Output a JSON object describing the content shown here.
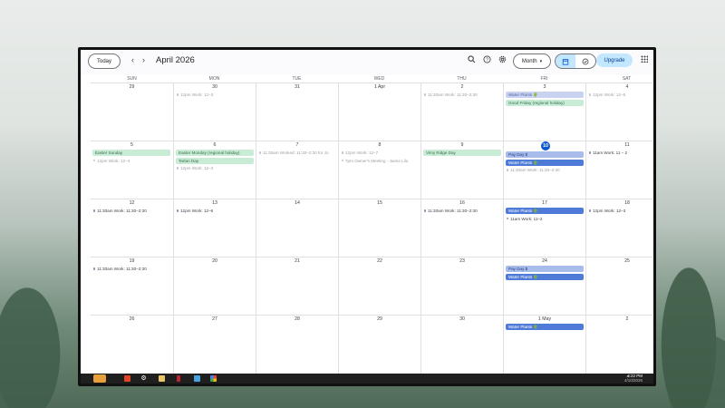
{
  "header": {
    "today_label": "Today",
    "month_title": "April 2026",
    "view_label": "Month",
    "upgrade_label": "Upgrade"
  },
  "dow": [
    "SUN",
    "MON",
    "TUE",
    "WED",
    "THU",
    "FRI",
    "SAT"
  ],
  "weeks": [
    {
      "days": [
        {
          "date": "29",
          "events": []
        },
        {
          "date": "30",
          "events": [
            {
              "type": "dot",
              "faded": true,
              "text": "12pm Work: 12–3"
            }
          ]
        },
        {
          "date": "31",
          "events": []
        },
        {
          "date": "1 Apr",
          "events": []
        },
        {
          "date": "2",
          "events": [
            {
              "type": "dot",
              "faded": true,
              "text": "11:30am Work: 11:30–2:30"
            }
          ]
        },
        {
          "date": "3",
          "events": [
            {
              "type": "chip-lav",
              "text": "Water Plants 🌵"
            },
            {
              "type": "chip-green",
              "text": "Good Friday (regional holiday)"
            }
          ]
        },
        {
          "date": "4",
          "events": [
            {
              "type": "dot",
              "faded": true,
              "text": "12pm Work: 12–5"
            }
          ]
        }
      ]
    },
    {
      "days": [
        {
          "date": "5",
          "events": [
            {
              "type": "chip-green",
              "text": "Easter Sunday"
            },
            {
              "type": "dot",
              "faded": true,
              "text": "12pm Work: 12–4"
            }
          ]
        },
        {
          "date": "6",
          "events": [
            {
              "type": "chip-green",
              "text": "Easter Monday (regional holiday)"
            },
            {
              "type": "chip-green",
              "text": "Tartan Day"
            },
            {
              "type": "dot",
              "faded": true,
              "text": "12pm Work: 12–3"
            }
          ]
        },
        {
          "date": "7",
          "events": [
            {
              "type": "dot",
              "faded": true,
              "text": "11:30am Worked: 11:30–2:30 for Jo"
            }
          ]
        },
        {
          "date": "8",
          "events": [
            {
              "type": "dot",
              "faded": true,
              "text": "12pm Work: 12–7"
            },
            {
              "type": "dot",
              "faded": true,
              "text": "7pm Owner's Meeting - Jaime Lilo"
            }
          ]
        },
        {
          "date": "9",
          "events": [
            {
              "type": "chip-green",
              "text": "Vimy Ridge Day"
            }
          ]
        },
        {
          "date": "10",
          "today": true,
          "events": [
            {
              "type": "chip-lblue",
              "text": "Pay Day $"
            },
            {
              "type": "chip-blue",
              "text": "Water Plants 🌵"
            },
            {
              "type": "dot",
              "faded": true,
              "text": "11:30am Work: 11:30–2:30"
            }
          ]
        },
        {
          "date": "11",
          "events": [
            {
              "type": "dot",
              "text": "11am Work: 11 – 2"
            }
          ]
        }
      ]
    },
    {
      "days": [
        {
          "date": "12",
          "events": [
            {
              "type": "dot",
              "text": "11:30am Work: 11:30–2:30"
            }
          ]
        },
        {
          "date": "13",
          "events": [
            {
              "type": "dot",
              "text": "12pm Work: 12–6"
            }
          ]
        },
        {
          "date": "14",
          "events": []
        },
        {
          "date": "15",
          "events": []
        },
        {
          "date": "16",
          "events": [
            {
              "type": "dot",
              "text": "11:30am Work: 11:30–2:30"
            }
          ]
        },
        {
          "date": "17",
          "events": [
            {
              "type": "chip-blue",
              "text": "Water Plants 🌵"
            },
            {
              "type": "dot",
              "text": "11am Work: 11–2"
            }
          ]
        },
        {
          "date": "18",
          "events": [
            {
              "type": "dot",
              "text": "12pm Work: 12–3"
            }
          ]
        }
      ]
    },
    {
      "days": [
        {
          "date": "19",
          "events": [
            {
              "type": "dot",
              "text": "11:30am Work: 11:30–2:30"
            }
          ]
        },
        {
          "date": "20",
          "events": []
        },
        {
          "date": "21",
          "events": []
        },
        {
          "date": "22",
          "events": []
        },
        {
          "date": "23",
          "events": []
        },
        {
          "date": "24",
          "events": [
            {
              "type": "chip-lblue",
              "text": "Pay Day $"
            },
            {
              "type": "chip-blue",
              "text": "Water Plants 🌵"
            }
          ]
        },
        {
          "date": "25",
          "events": []
        }
      ]
    },
    {
      "days": [
        {
          "date": "26",
          "events": []
        },
        {
          "date": "27",
          "events": []
        },
        {
          "date": "28",
          "events": []
        },
        {
          "date": "29",
          "events": []
        },
        {
          "date": "30",
          "events": []
        },
        {
          "date": "1 May",
          "events": [
            {
              "type": "chip-blue",
              "text": "Water Plants 🌵"
            }
          ]
        },
        {
          "date": "2",
          "events": []
        }
      ]
    }
  ],
  "taskbar": {
    "time": "4:22 PM",
    "date": "4/10/2026"
  }
}
